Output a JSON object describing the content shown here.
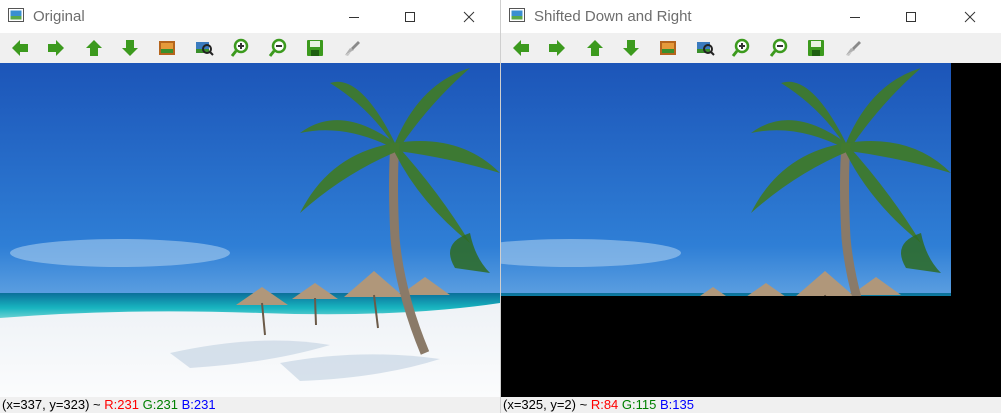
{
  "windows": [
    {
      "title": "Original",
      "toolbar": [
        "arrow-left-icon",
        "arrow-right-icon",
        "arrow-up-icon",
        "arrow-down-icon",
        "image-icon",
        "zoom-image-icon",
        "zoom-in-icon",
        "zoom-out-icon",
        "save-icon",
        "properties-icon"
      ],
      "status": {
        "coords": "(x=337, y=323) ~ ",
        "r": "R:231",
        "g": "G:231",
        "b": "B:231"
      }
    },
    {
      "title": "Shifted Down and Right",
      "toolbar": [
        "arrow-left-icon",
        "arrow-right-icon",
        "arrow-up-icon",
        "arrow-down-icon",
        "image-icon",
        "zoom-image-icon",
        "zoom-in-icon",
        "zoom-out-icon",
        "save-icon",
        "properties-icon"
      ],
      "status": {
        "coords": "(x=325, y=2) ~ ",
        "r": "R:84",
        "g": "G:115",
        "b": "B:135"
      }
    }
  ],
  "colors": {
    "r": "#ff0000",
    "g": "#008000",
    "b": "#0000ff",
    "arrow_green": "#3c9a1e",
    "sky_top": "#1f5fc0",
    "sea": "#1fb0b8",
    "sand": "#f4f6f8"
  }
}
